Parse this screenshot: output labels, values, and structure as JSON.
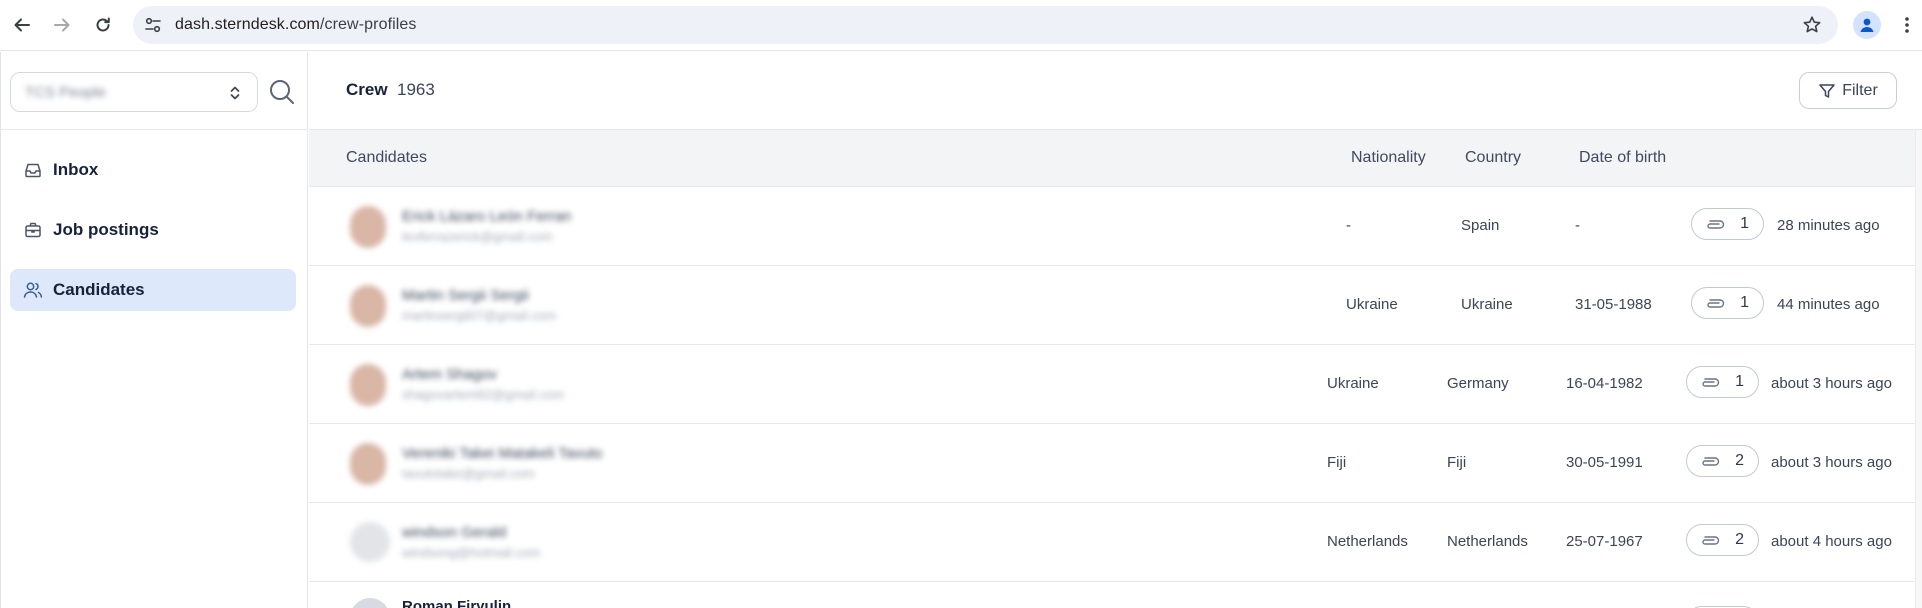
{
  "browser": {
    "url_domain": "dash.sterndesk.com",
    "url_path": "/crew-profiles"
  },
  "sidebar": {
    "workspace": "TCS People",
    "items": [
      {
        "label": "Inbox",
        "icon": "inbox-icon"
      },
      {
        "label": "Job postings",
        "icon": "briefcase-icon"
      },
      {
        "label": "Candidates",
        "icon": "users-icon",
        "active": true
      }
    ]
  },
  "header": {
    "title": "Crew",
    "count": "1963",
    "filter_label": "Filter"
  },
  "table": {
    "columns": {
      "candidates": "Candidates",
      "nationality": "Nationality",
      "country": "Country",
      "dob": "Date of birth"
    },
    "rows": [
      {
        "name": "Erick Lázaro León Ferran",
        "email": "leoferrazerick@gmail.com",
        "nationality": "-",
        "country": "Spain",
        "dob": "-",
        "attachments": "1",
        "when": "28 minutes ago"
      },
      {
        "name": "Martin Sergii Sergii",
        "email": "martinsergii07@gmail.com",
        "nationality": "Ukraine",
        "country": "Ukraine",
        "dob": "31-05-1988",
        "attachments": "1",
        "when": "44 minutes ago"
      },
      {
        "name": "Artem Shagov",
        "email": "shagovartem82@gmail.com",
        "nationality": "Ukraine",
        "country": "Germany",
        "dob": "16-04-1982",
        "attachments": "1",
        "when": "about 3 hours ago"
      },
      {
        "name": "Vereniki Takei Matakeli Tavuto",
        "email": "tavutotake@gmail.com",
        "nationality": "Fiji",
        "country": "Fiji",
        "dob": "30-05-1991",
        "attachments": "2",
        "when": "about 3 hours ago"
      },
      {
        "name": "windson Gerald",
        "email": "windsong@hotmail.com",
        "nationality": "Netherlands",
        "country": "Netherlands",
        "dob": "25-07-1967",
        "attachments": "2",
        "when": "about 4 hours ago"
      }
    ],
    "partial_row_name": "Roman Firyulin"
  },
  "colors": {
    "accent_active_bg": "#dde8fb",
    "header_bg": "#f3f4f6",
    "avatar_placeholder": "#d9b6a6"
  }
}
